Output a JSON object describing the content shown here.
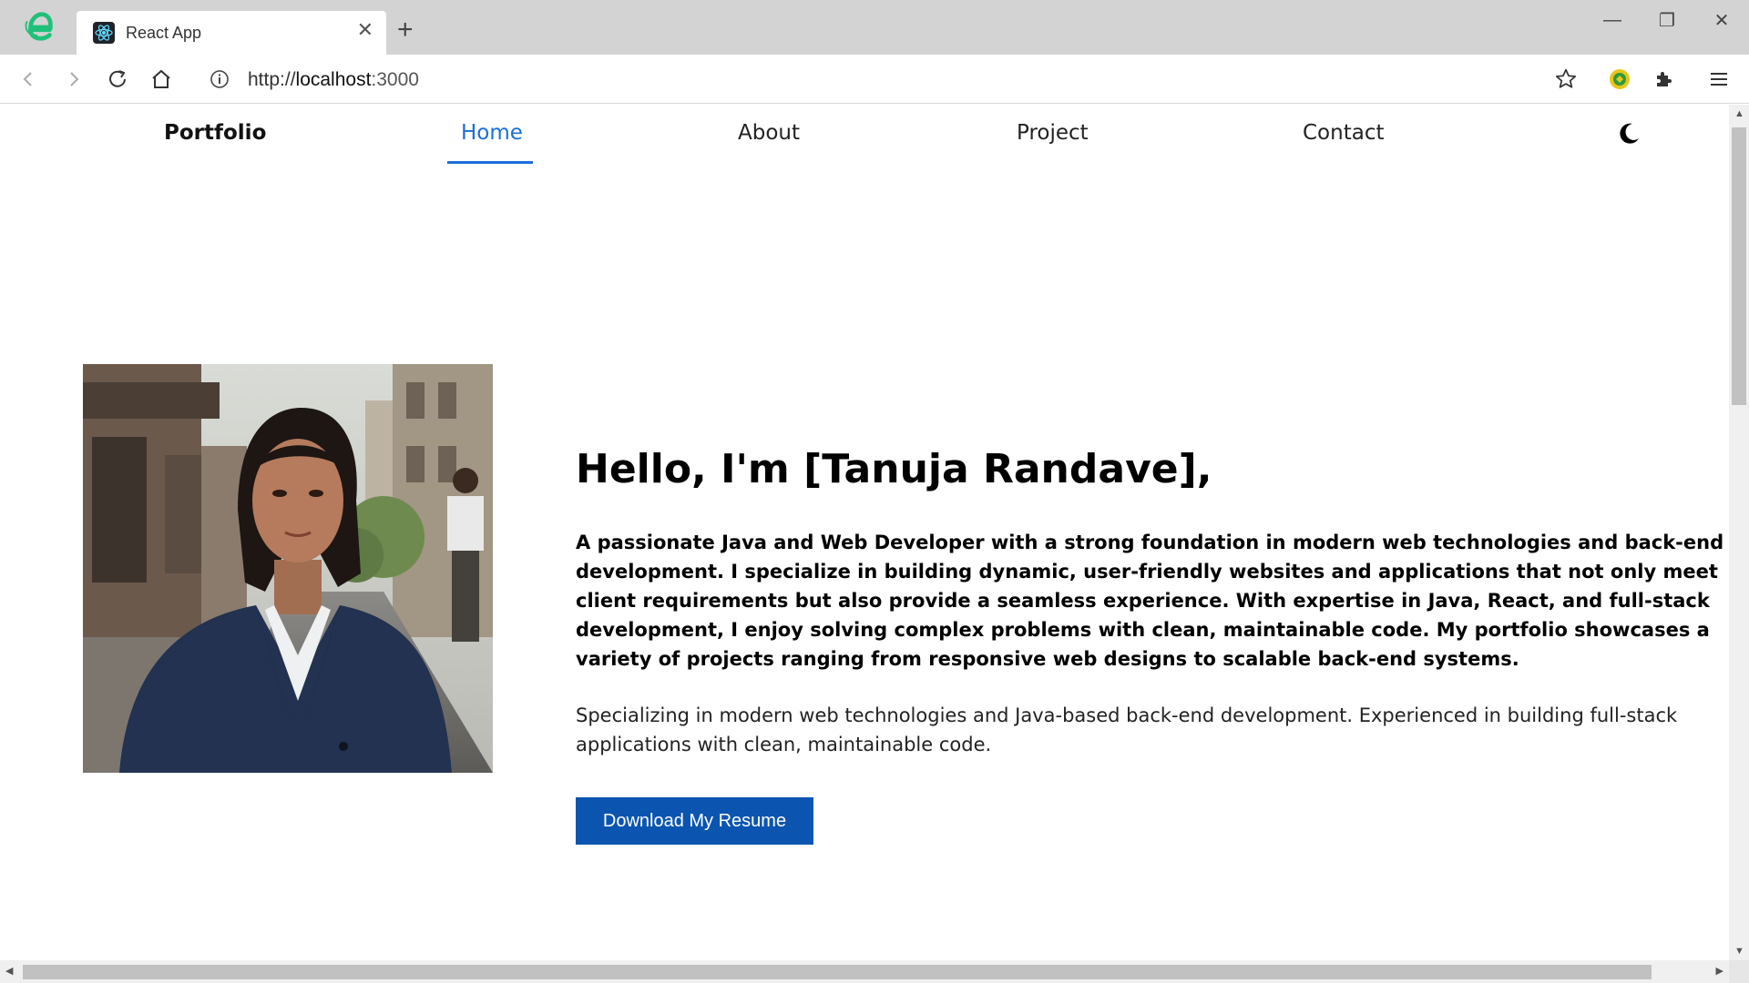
{
  "browser": {
    "tab_title": "React App",
    "tab_close_glyph": "✕",
    "new_tab_glyph": "+",
    "url": {
      "scheme": "http://",
      "host": "localhost",
      "port": ":3000"
    },
    "window_controls": [
      "—",
      "❐",
      "✕"
    ],
    "icons": [
      "browser-logo-icon",
      "react-favicon-icon",
      "back-arrow-icon",
      "forward-arrow-icon",
      "reload-icon",
      "home-icon",
      "info-icon",
      "star-icon",
      "extension-badge-icon",
      "puzzle-icon",
      "menu-icon"
    ]
  },
  "site": {
    "brand": "Portfolio",
    "nav": [
      "Home",
      "About",
      "Project",
      "Contact"
    ],
    "active_nav": "Home",
    "theme_icon": "moon-icon"
  },
  "hero": {
    "title": "Hello, I'm [Tanuja Randave],",
    "intro": "A passionate Java and Web Developer with a strong foundation in modern web technologies and back-end development. I specialize in building dynamic, user-friendly websites and applications that not only meet client requirements but also provide a seamless experience. With expertise in Java, React, and full-stack development, I enjoy solving complex problems with clean, maintainable code. My portfolio showcases a variety of projects ranging from responsive web designs to scalable back-end systems.",
    "description": "Specializing in modern web technologies and Java-based back-end development. Experienced in building full-stack applications with clean, maintainable code.",
    "button_label": "Download My Resume"
  },
  "colors": {
    "accent": "#1a6fd9",
    "button": "#0b55b1",
    "chrome": "#d3d3d3"
  }
}
